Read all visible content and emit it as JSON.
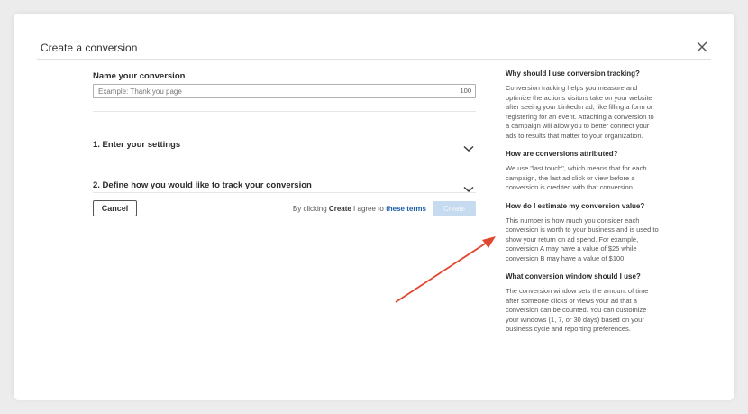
{
  "modal": {
    "title": "Create a conversion"
  },
  "form": {
    "name_label": "Name your conversion",
    "name_placeholder": "Example: Thank you page",
    "name_value": "",
    "char_count": "100",
    "sections": [
      {
        "label": "1. Enter your settings"
      },
      {
        "label": "2. Define how you would like to track your conversion"
      }
    ],
    "cancel_label": "Cancel",
    "terms_prefix": "By clicking ",
    "terms_strong": "Create",
    "terms_middle": " I agree to ",
    "terms_link": "these terms",
    "create_label": "Create"
  },
  "sidebar": {
    "faqs": [
      {
        "question": "Why should I use conversion tracking?",
        "answer": "Conversion tracking helps you measure and optimize the actions visitors take on your website after seeing your LinkedIn ad, like filling a form or registering for an event. Attaching a conversion to a campaign will allow you to better connect your ads to results that matter to your organization."
      },
      {
        "question": "How are conversions attributed?",
        "answer": "We use \"last touch\", which means that for each campaign, the last ad click or view before a conversion is credited with that conversion."
      },
      {
        "question": "How do I estimate my conversion value?",
        "answer": "This number is how much you consider each conversion is worth to your business and is used to show your return on ad spend. For example, conversion A may have a value of $25 while conversion B may have a value of $100."
      },
      {
        "question": "What conversion window should I use?",
        "answer": "The conversion window sets the amount of time after someone clicks or views your ad that a conversion can be counted. You can customize your windows (1, 7, or 30 days) based on your business cycle and reporting preferences."
      }
    ]
  },
  "colors": {
    "link": "#1a5ea8",
    "create_disabled_bg": "#c6daf0",
    "annotation_arrow": "#e0472f"
  },
  "icons": [
    "close-icon",
    "chevron-down-icon",
    "annotation-arrow"
  ]
}
